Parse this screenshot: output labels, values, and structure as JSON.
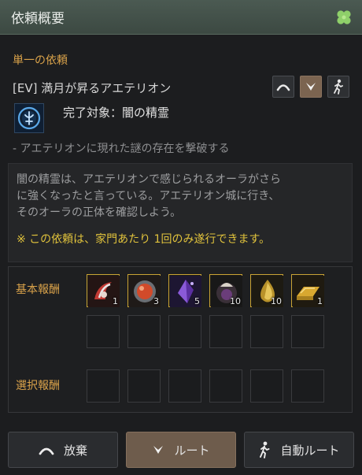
{
  "window": {
    "title": "依頼概要",
    "icon": "clover-icon"
  },
  "quest": {
    "type_label": "単一の依頼",
    "name": "[EV] 満月が昇るアエテリオン",
    "target": "完了対象：闇の精霊",
    "summary": "- アエテリオンに現れた謎の存在を撃破する",
    "description": [
      "闇の精霊は、アエテリオンで感じられるオーラがさら",
      "に強くなったと言っている。アエテリオン城に行き、",
      "そのオーラの正体を確認しよう。"
    ],
    "note": "※ この依頼は、家門あたり 1回のみ遂行できます。"
  },
  "rewards": {
    "basic_label": "基本報酬",
    "choice_label": "選択報酬",
    "basic_items": [
      {
        "icon": "horn-item-icon",
        "count": "1"
      },
      {
        "icon": "red-orb-item-icon",
        "count": "3"
      },
      {
        "icon": "purple-crystal-item-icon",
        "count": "5"
      },
      {
        "icon": "dark-pouch-item-icon",
        "count": "10"
      },
      {
        "icon": "golden-drop-item-icon",
        "count": "10"
      },
      {
        "icon": "gold-bar-item-icon",
        "count": "1"
      }
    ]
  },
  "buttons": {
    "abandon": "放棄",
    "route": "ルート",
    "auto_route": "自動ルート"
  },
  "colors": {
    "accent": "#d9a24a",
    "note": "#e0c23c",
    "title_bar": "#4b5a52",
    "route_button": "#6e5c4c"
  }
}
